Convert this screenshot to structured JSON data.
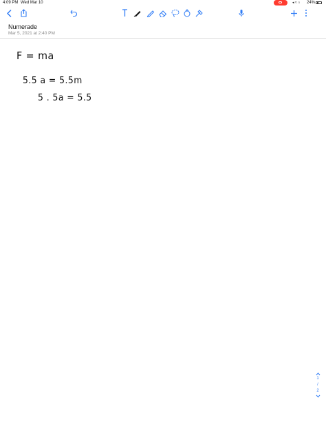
{
  "status_bar": {
    "time": "4:09 PM",
    "date": "Wed Mar 10",
    "battery": "24%",
    "recording_color": "#ff3b30"
  },
  "toolbar": {
    "accent": "#2f7cf6",
    "icons": [
      "back-chevron-icon",
      "share-icon",
      "undo-icon",
      "text-tool-icon",
      "pen-icon",
      "pencil-icon",
      "eraser-icon",
      "lasso-icon",
      "shapes-icon",
      "elements-icon",
      "microphone-icon",
      "add-icon",
      "more-icon"
    ]
  },
  "note": {
    "title": "Numerade",
    "subtitle": "Mar 5, 2021 at 2:40 PM"
  },
  "handwriting": {
    "line1": "F = ma",
    "line2": "5.5 a  = 5.5m",
    "line3": "5 . 5a = 5.5"
  },
  "pager": {
    "current": "1",
    "separator": "/",
    "total": "2"
  }
}
